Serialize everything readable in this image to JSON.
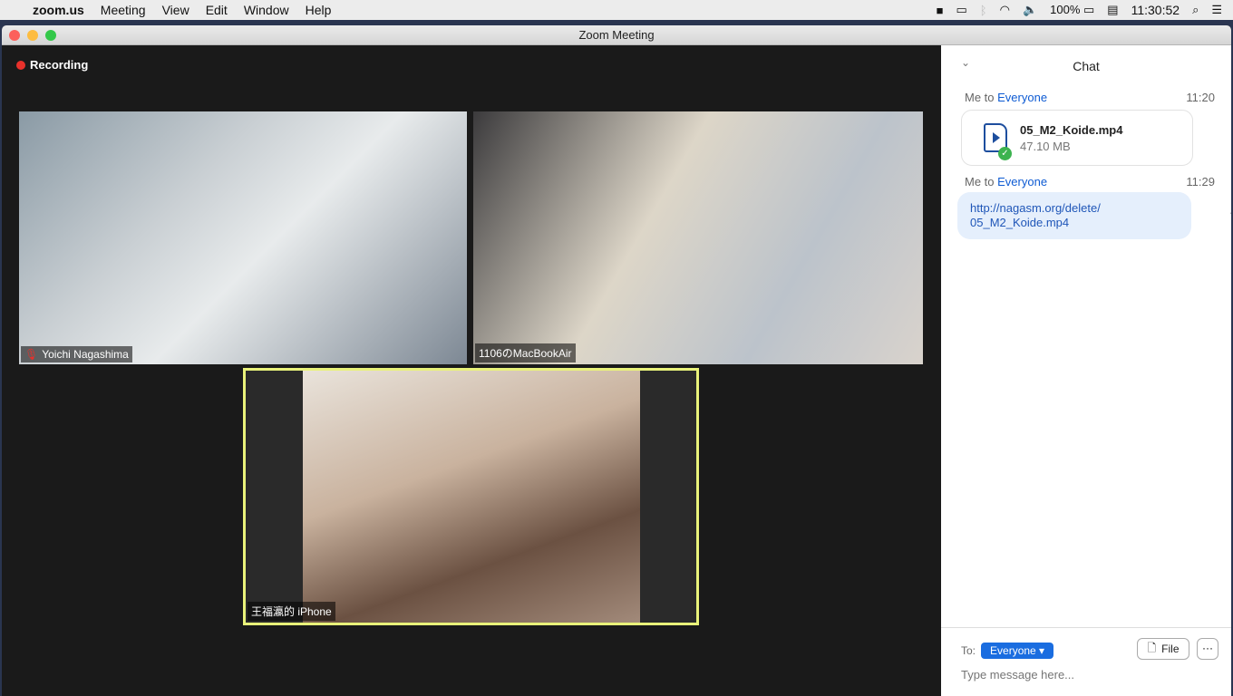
{
  "menubar": {
    "app": "zoom.us",
    "items": [
      "Meeting",
      "View",
      "Edit",
      "Window",
      "Help"
    ],
    "battery": "100%",
    "time": "11:30:52"
  },
  "window": {
    "title": "Zoom Meeting"
  },
  "video": {
    "recording": "Recording",
    "tiles": [
      {
        "name": "Yoichi Nagashima"
      },
      {
        "name": "1106のMacBookAir"
      },
      {
        "name": "王福瀛的 iPhone"
      }
    ]
  },
  "chat": {
    "title": "Chat",
    "messages": [
      {
        "from": "Me to ",
        "to": "Everyone",
        "time": "11:20",
        "file_name": "05_M2_Koide.mp4",
        "file_size": "47.10 MB"
      },
      {
        "from": "Me to ",
        "to": "Everyone",
        "time": "11:29",
        "text": "http://nagasm.org/delete/ 05_M2_Koide.mp4",
        "more": "···"
      }
    ],
    "to_label": "To:",
    "recipient": "Everyone ▾",
    "file_button": "File",
    "more_button": "···",
    "placeholder": "Type message here..."
  },
  "colors": {
    "accent": "#1a6de0",
    "recording": "#e8312b",
    "active_speaker": "#e9f27a"
  }
}
